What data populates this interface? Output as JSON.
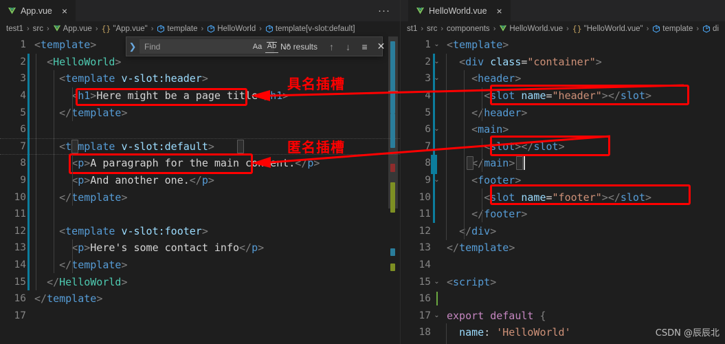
{
  "panels": {
    "left": {
      "tab": {
        "label": "App.vue",
        "icon": "vue-icon",
        "close": "×"
      },
      "tabbar_more": "···",
      "breadcrumb": [
        {
          "text": "test1",
          "icon": ""
        },
        {
          "text": "src",
          "icon": ""
        },
        {
          "text": "App.vue",
          "icon": "vue-icon"
        },
        {
          "text": "\"App.vue\"",
          "icon": "braces-icon"
        },
        {
          "text": "template",
          "icon": "symbol-icon"
        },
        {
          "text": "HelloWorld",
          "icon": "symbol-icon"
        },
        {
          "text": "template[v-slot:default]",
          "icon": "symbol-icon"
        }
      ],
      "breadcrumb_separator": "›",
      "code_lines": [
        {
          "n": "1",
          "indent": 0,
          "tokens": [
            [
              "punc",
              "<"
            ],
            [
              "tag",
              "template"
            ],
            [
              "punc",
              ">"
            ]
          ]
        },
        {
          "n": "2",
          "indent": 1,
          "tokens": [
            [
              "punc",
              "<"
            ],
            [
              "comp",
              "HelloWorld"
            ],
            [
              "punc",
              ">"
            ]
          ]
        },
        {
          "n": "3",
          "indent": 2,
          "tokens": [
            [
              "punc",
              "<"
            ],
            [
              "tag",
              "template"
            ],
            [
              "txt",
              " "
            ],
            [
              "attr",
              "v-slot:header"
            ],
            [
              "punc",
              ">"
            ]
          ]
        },
        {
          "n": "4",
          "indent": 3,
          "tokens": [
            [
              "punc",
              "<"
            ],
            [
              "tag",
              "h1"
            ],
            [
              "punc",
              ">"
            ],
            [
              "txt",
              "Here might be a page title"
            ],
            [
              "punc",
              "</"
            ],
            [
              "tag",
              "h1"
            ],
            [
              "punc",
              ">"
            ]
          ]
        },
        {
          "n": "5",
          "indent": 2,
          "tokens": [
            [
              "punc",
              "</"
            ],
            [
              "tag",
              "template"
            ],
            [
              "punc",
              ">"
            ]
          ]
        },
        {
          "n": "6",
          "indent": 0,
          "tokens": []
        },
        {
          "n": "7",
          "indent": 2,
          "tokens": [
            [
              "punc",
              "<"
            ],
            [
              "tag",
              "template"
            ],
            [
              "txt",
              " "
            ],
            [
              "attr",
              "v-slot:default"
            ],
            [
              "punc",
              ">"
            ]
          ]
        },
        {
          "n": "8",
          "indent": 3,
          "tokens": [
            [
              "punc",
              "<"
            ],
            [
              "tag",
              "p"
            ],
            [
              "punc",
              ">"
            ],
            [
              "txt",
              "A paragraph for the main content."
            ],
            [
              "punc",
              "</"
            ],
            [
              "tag",
              "p"
            ],
            [
              "punc",
              ">"
            ]
          ]
        },
        {
          "n": "9",
          "indent": 3,
          "tokens": [
            [
              "punc",
              "<"
            ],
            [
              "tag",
              "p"
            ],
            [
              "punc",
              ">"
            ],
            [
              "txt",
              "And another one."
            ],
            [
              "punc",
              "</"
            ],
            [
              "tag",
              "p"
            ],
            [
              "punc",
              ">"
            ]
          ]
        },
        {
          "n": "10",
          "indent": 2,
          "tokens": [
            [
              "punc",
              "</"
            ],
            [
              "tag",
              "template"
            ],
            [
              "punc",
              ">"
            ]
          ]
        },
        {
          "n": "11",
          "indent": 0,
          "tokens": []
        },
        {
          "n": "12",
          "indent": 2,
          "tokens": [
            [
              "punc",
              "<"
            ],
            [
              "tag",
              "template"
            ],
            [
              "txt",
              " "
            ],
            [
              "attr",
              "v-slot:footer"
            ],
            [
              "punc",
              ">"
            ]
          ]
        },
        {
          "n": "13",
          "indent": 3,
          "tokens": [
            [
              "punc",
              "<"
            ],
            [
              "tag",
              "p"
            ],
            [
              "punc",
              ">"
            ],
            [
              "txt",
              "Here's some contact info"
            ],
            [
              "punc",
              "</"
            ],
            [
              "tag",
              "p"
            ],
            [
              "punc",
              ">"
            ]
          ]
        },
        {
          "n": "14",
          "indent": 2,
          "tokens": [
            [
              "punc",
              "</"
            ],
            [
              "tag",
              "template"
            ],
            [
              "punc",
              ">"
            ]
          ]
        },
        {
          "n": "15",
          "indent": 1,
          "tokens": [
            [
              "punc",
              "</"
            ],
            [
              "comp",
              "HelloWorld"
            ],
            [
              "punc",
              ">"
            ]
          ]
        },
        {
          "n": "16",
          "indent": 0,
          "tokens": [
            [
              "punc",
              "</"
            ],
            [
              "tag",
              "template"
            ],
            [
              "punc",
              ">"
            ]
          ]
        },
        {
          "n": "17",
          "indent": 0,
          "tokens": []
        }
      ]
    },
    "right": {
      "tab": {
        "label": "HelloWorld.vue",
        "icon": "vue-icon",
        "close": "×"
      },
      "breadcrumb": [
        {
          "text": "st1",
          "icon": ""
        },
        {
          "text": "src",
          "icon": ""
        },
        {
          "text": "components",
          "icon": ""
        },
        {
          "text": "HelloWorld.vue",
          "icon": "vue-icon"
        },
        {
          "text": "\"HelloWorld.vue\"",
          "icon": "braces-icon"
        },
        {
          "text": "template",
          "icon": "symbol-icon"
        },
        {
          "text": "di",
          "icon": "symbol-icon"
        }
      ],
      "breadcrumb_separator": "›",
      "code_lines": [
        {
          "n": "1",
          "indent": 0,
          "fold": "v",
          "tokens": [
            [
              "punc",
              "<"
            ],
            [
              "tag",
              "template"
            ],
            [
              "punc",
              ">"
            ]
          ]
        },
        {
          "n": "2",
          "indent": 1,
          "fold": "v",
          "tokens": [
            [
              "punc",
              "<"
            ],
            [
              "tag",
              "div"
            ],
            [
              "txt",
              " "
            ],
            [
              "attr",
              "class"
            ],
            [
              "eq",
              "="
            ],
            [
              "str",
              "\"container\""
            ],
            [
              "punc",
              ">"
            ]
          ]
        },
        {
          "n": "3",
          "indent": 2,
          "fold": "v",
          "tokens": [
            [
              "punc",
              "<"
            ],
            [
              "tag",
              "header"
            ],
            [
              "punc",
              ">"
            ]
          ]
        },
        {
          "n": "4",
          "indent": 3,
          "fold": "",
          "tokens": [
            [
              "punc",
              "<"
            ],
            [
              "tag",
              "slot"
            ],
            [
              "txt",
              " "
            ],
            [
              "attr",
              "name"
            ],
            [
              "eq",
              "="
            ],
            [
              "str",
              "\"header\""
            ],
            [
              "punc",
              ">"
            ],
            [
              "punc",
              "</"
            ],
            [
              "tag",
              "slot"
            ],
            [
              "punc",
              ">"
            ]
          ]
        },
        {
          "n": "5",
          "indent": 2,
          "fold": "",
          "tokens": [
            [
              "punc",
              "</"
            ],
            [
              "tag",
              "header"
            ],
            [
              "punc",
              ">"
            ]
          ]
        },
        {
          "n": "6",
          "indent": 2,
          "fold": "v",
          "tokens": [
            [
              "punc",
              "<"
            ],
            [
              "tag",
              "main"
            ],
            [
              "punc",
              ">"
            ]
          ]
        },
        {
          "n": "7",
          "indent": 3,
          "fold": "",
          "tokens": [
            [
              "punc",
              "<"
            ],
            [
              "tag",
              "slot"
            ],
            [
              "punc",
              ">"
            ],
            [
              "punc",
              "</"
            ],
            [
              "tag",
              "slot"
            ],
            [
              "punc",
              ">"
            ]
          ]
        },
        {
          "n": "8",
          "indent": 2,
          "fold": "",
          "tokens": [
            [
              "punc",
              "</"
            ],
            [
              "tag",
              "main"
            ],
            [
              "punc",
              ">"
            ]
          ]
        },
        {
          "n": "9",
          "indent": 2,
          "fold": "v",
          "tokens": [
            [
              "punc",
              "<"
            ],
            [
              "tag",
              "footer"
            ],
            [
              "punc",
              ">"
            ]
          ]
        },
        {
          "n": "10",
          "indent": 3,
          "fold": "",
          "tokens": [
            [
              "punc",
              "<"
            ],
            [
              "tag",
              "slot"
            ],
            [
              "txt",
              " "
            ],
            [
              "attr",
              "name"
            ],
            [
              "eq",
              "="
            ],
            [
              "str",
              "\"footer\""
            ],
            [
              "punc",
              ">"
            ],
            [
              "punc",
              "</"
            ],
            [
              "tag",
              "slot"
            ],
            [
              "punc",
              ">"
            ]
          ]
        },
        {
          "n": "11",
          "indent": 2,
          "fold": "",
          "tokens": [
            [
              "punc",
              "</"
            ],
            [
              "tag",
              "footer"
            ],
            [
              "punc",
              ">"
            ]
          ]
        },
        {
          "n": "12",
          "indent": 1,
          "fold": "",
          "tokens": [
            [
              "punc",
              "</"
            ],
            [
              "tag",
              "div"
            ],
            [
              "punc",
              ">"
            ]
          ]
        },
        {
          "n": "13",
          "indent": 0,
          "fold": "",
          "tokens": [
            [
              "punc",
              "</"
            ],
            [
              "tag",
              "template"
            ],
            [
              "punc",
              ">"
            ]
          ]
        },
        {
          "n": "14",
          "indent": 0,
          "fold": "",
          "tokens": []
        },
        {
          "n": "15",
          "indent": 0,
          "fold": "v",
          "tokens": [
            [
              "punc",
              "<"
            ],
            [
              "tag",
              "script"
            ],
            [
              "punc",
              ">"
            ]
          ]
        },
        {
          "n": "16",
          "indent": 0,
          "fold": "",
          "tokens": []
        },
        {
          "n": "17",
          "indent": 0,
          "fold": "v",
          "tokens": [
            [
              "kw",
              "export default"
            ],
            [
              "txt",
              " "
            ],
            [
              "punc",
              "{"
            ]
          ]
        },
        {
          "n": "18",
          "indent": 1,
          "fold": "",
          "tokens": [
            [
              "prop",
              "name"
            ],
            [
              "eq",
              ": "
            ],
            [
              "str",
              "'HelloWorld'"
            ]
          ]
        }
      ]
    }
  },
  "find_widget": {
    "toggle_icon": "chevron-right-icon",
    "placeholder": "Find",
    "value": "",
    "match_case_label": "Aa",
    "whole_word_label": "Ab",
    "regex_label": ".*",
    "results_text": "No results",
    "prev_icon": "↑",
    "next_icon": "↓",
    "selection_icon": "≡",
    "close_icon": "✕"
  },
  "annotations": {
    "named_slot_label": "具名插槽",
    "anonymous_slot_label": "匿名插槽",
    "highlight_color": "#ff0000"
  },
  "watermark": "CSDN @辰辰北",
  "theme": {
    "editor_bg": "#1e1e1e",
    "tabbar_bg": "#252526",
    "tag": "#569cd6",
    "component": "#4ec9b0",
    "attribute": "#9cdcfe",
    "string": "#ce9178",
    "keyword": "#c586c0",
    "text": "#d4d4d4",
    "line_number": "#858585",
    "change_bar": "#0c7d9d"
  }
}
